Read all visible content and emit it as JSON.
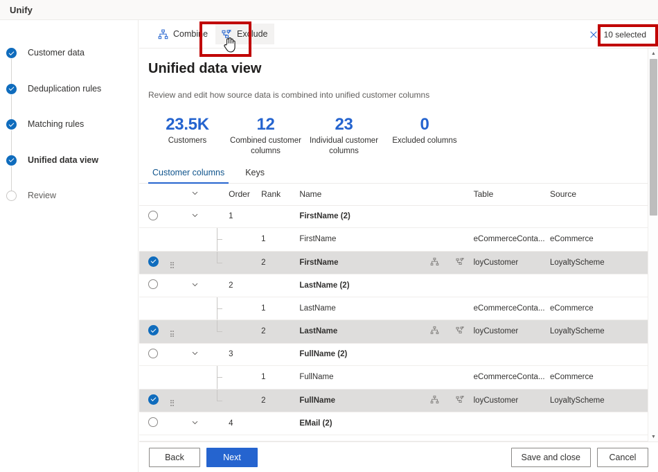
{
  "window": {
    "title": "Unify"
  },
  "sidebar": {
    "steps": [
      {
        "label": "Customer data",
        "state": "done"
      },
      {
        "label": "Deduplication rules",
        "state": "done"
      },
      {
        "label": "Matching rules",
        "state": "done"
      },
      {
        "label": "Unified data view",
        "state": "current"
      },
      {
        "label": "Review",
        "state": "todo"
      }
    ]
  },
  "commandbar": {
    "combine_label": "Combine",
    "exclude_label": "Exclude",
    "selected_label": "10 selected",
    "combine_icon": "combine-hierarchy-icon",
    "exclude_icon": "exclude-node-icon",
    "clear_icon": "close-x-icon"
  },
  "page": {
    "title": "Unified data view",
    "subtitle": "Review and edit how source data is combined into unified customer columns"
  },
  "stats": [
    {
      "value": "23.5K",
      "caption": "Customers"
    },
    {
      "value": "12",
      "caption": "Combined customer columns"
    },
    {
      "value": "23",
      "caption": "Individual customer columns"
    },
    {
      "value": "0",
      "caption": "Excluded columns"
    }
  ],
  "tabs": [
    {
      "label": "Customer columns",
      "active": true
    },
    {
      "label": "Keys",
      "active": false
    }
  ],
  "table": {
    "headers": {
      "chevron": "",
      "order": "Order",
      "rank": "Rank",
      "name": "Name",
      "table": "Table",
      "source": "Source"
    },
    "groups": [
      {
        "order": "1",
        "name": "FirstName (2)",
        "checked": false,
        "expanded": true,
        "children": [
          {
            "rank": "1",
            "name": "FirstName",
            "table": "eCommerceConta...",
            "source": "eCommerce",
            "selected": false,
            "actions": false
          },
          {
            "rank": "2",
            "name": "FirstName",
            "table": "loyCustomer",
            "source": "LoyaltyScheme",
            "selected": true,
            "actions": true
          }
        ]
      },
      {
        "order": "2",
        "name": "LastName (2)",
        "checked": false,
        "expanded": true,
        "children": [
          {
            "rank": "1",
            "name": "LastName",
            "table": "eCommerceConta...",
            "source": "eCommerce",
            "selected": false,
            "actions": false
          },
          {
            "rank": "2",
            "name": "LastName",
            "table": "loyCustomer",
            "source": "LoyaltyScheme",
            "selected": true,
            "actions": true
          }
        ]
      },
      {
        "order": "3",
        "name": "FullName (2)",
        "checked": false,
        "expanded": true,
        "children": [
          {
            "rank": "1",
            "name": "FullName",
            "table": "eCommerceConta...",
            "source": "eCommerce",
            "selected": false,
            "actions": false
          },
          {
            "rank": "2",
            "name": "FullName",
            "table": "loyCustomer",
            "source": "LoyaltyScheme",
            "selected": true,
            "actions": true
          }
        ]
      },
      {
        "order": "4",
        "name": "EMail (2)",
        "checked": false,
        "expanded": true,
        "children": []
      }
    ]
  },
  "footer": {
    "back": "Back",
    "next": "Next",
    "save_and_close": "Save and close",
    "cancel": "Cancel"
  },
  "colors": {
    "accent": "#2564cf",
    "accent_deep": "#0f6cbd",
    "highlight": "#c00000",
    "selected_row": "#dedddc",
    "header_bg": "#faf9f8"
  }
}
